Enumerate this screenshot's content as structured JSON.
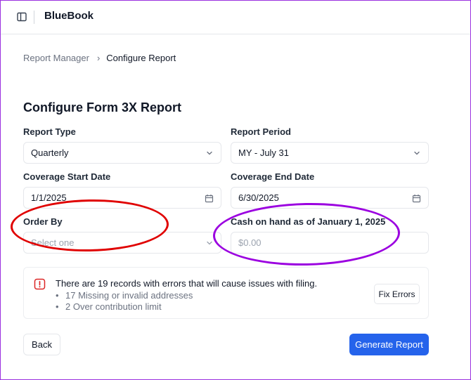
{
  "app": {
    "title": "BlueBook"
  },
  "breadcrumb": {
    "parent": "Report Manager",
    "separator": "›",
    "current": "Configure Report"
  },
  "page": {
    "title": "Configure Form 3X Report"
  },
  "form": {
    "report_type": {
      "label": "Report Type",
      "value": "Quarterly"
    },
    "report_period": {
      "label": "Report Period",
      "value": "MY - July 31"
    },
    "coverage_start": {
      "label": "Coverage Start Date",
      "value": "1/1/2025"
    },
    "coverage_end": {
      "label": "Coverage End Date",
      "value": "6/30/2025"
    },
    "order_by": {
      "label": "Order By",
      "placeholder": "Select one"
    },
    "cash_on_hand": {
      "label": "Cash on hand as of January 1, 2025",
      "value": "$0.00"
    }
  },
  "alert": {
    "message": "There are 19 records with errors that will cause issues with filing.",
    "items": [
      "17 Missing or invalid addresses",
      "2 Over contribution limit"
    ],
    "bullet": "•",
    "fix_label": "Fix Errors"
  },
  "actions": {
    "back_label": "Back",
    "generate_label": "Generate Report"
  },
  "colors": {
    "primary": "#2563eb",
    "error": "#dc2626",
    "annotation_red": "#e00000",
    "annotation_purple": "#9b00e0",
    "frame": "#9b30e0"
  },
  "icons": [
    "sidebar-icon",
    "chevron-down-icon",
    "calendar-icon",
    "alert-icon"
  ]
}
